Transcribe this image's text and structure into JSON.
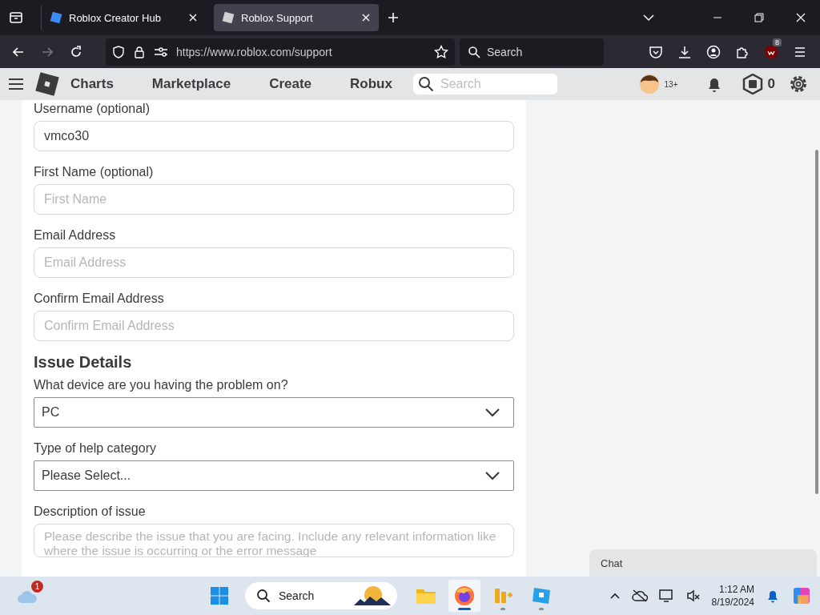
{
  "browser": {
    "tabs": [
      {
        "title": "Roblox Creator Hub",
        "selected": false
      },
      {
        "title": "Roblox Support",
        "selected": true
      }
    ],
    "url": "https://www.roblox.com/support",
    "search_placeholder": "Search",
    "extension_badge": "8"
  },
  "site_nav": {
    "items": [
      "Charts",
      "Marketplace",
      "Create",
      "Robux"
    ],
    "search_placeholder": "Search",
    "age_label": "13+",
    "robux": "0"
  },
  "form": [
    {
      "kind": "text",
      "label": "Username (optional)",
      "value": "vmco30"
    },
    {
      "kind": "text",
      "label": "First Name (optional)",
      "placeholder": "First Name"
    },
    {
      "kind": "text",
      "label": "Email Address",
      "placeholder": "Email Address"
    },
    {
      "kind": "text",
      "label": "Confirm Email Address",
      "placeholder": "Confirm Email Address"
    },
    {
      "kind": "heading",
      "label": "Issue Details"
    },
    {
      "kind": "select",
      "label": "What device are you having the problem on?",
      "value": "PC"
    },
    {
      "kind": "select",
      "label": "Type of help category",
      "value": "Please Select..."
    },
    {
      "kind": "textarea",
      "label": "Description of issue",
      "placeholder": "Please describe the issue that you are facing. Include any relevant information like where the issue is occurring or the error message"
    }
  ],
  "chat": {
    "label": "Chat"
  },
  "taskbar": {
    "weather_badge": "1",
    "search_placeholder": "Search",
    "time": "1:12 AM",
    "date": "8/19/2024",
    "apps": [
      {
        "kind": "files",
        "selected": false,
        "running": false
      },
      {
        "kind": "browser",
        "selected": true,
        "running": true
      },
      {
        "kind": "tool",
        "selected": false,
        "running": true
      },
      {
        "kind": "studio",
        "selected": false,
        "running": true
      }
    ]
  }
}
